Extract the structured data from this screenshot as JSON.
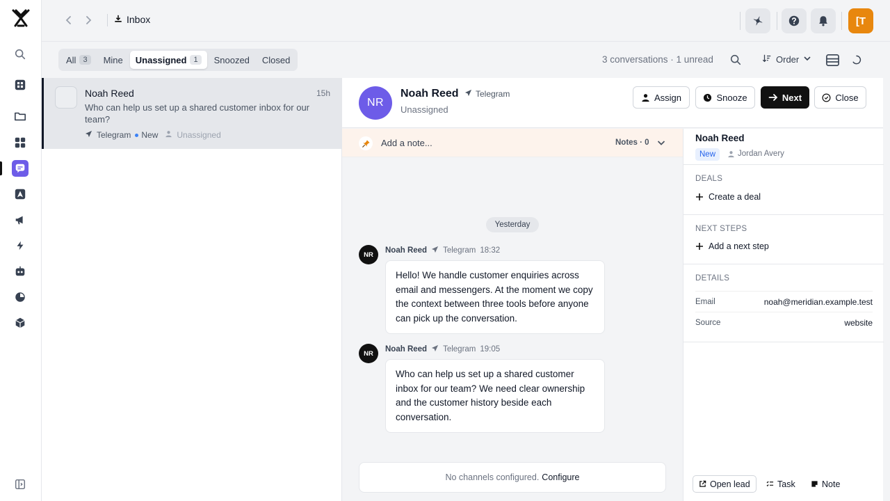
{
  "topbar": {
    "breadcrumb": "Inbox",
    "avatar_label": "[T"
  },
  "filters": [
    {
      "label": "All",
      "count": "3"
    },
    {
      "label": "Mine",
      "count": ""
    },
    {
      "label": "Unassigned",
      "count": "1"
    },
    {
      "label": "Snoozed",
      "count": ""
    },
    {
      "label": "Closed",
      "count": ""
    }
  ],
  "toolbar": {
    "summary": "3 conversations · 1 unread",
    "order_label": "Order"
  },
  "list": {
    "items": [
      {
        "name": "Noah Reed",
        "time": "15h",
        "preview": "Who can help us set up a shared customer inbox for our team?",
        "channel": "Telegram",
        "status": "New",
        "assignee": "Unassigned"
      }
    ]
  },
  "conversation": {
    "initials": "NR",
    "name": "Noah Reed",
    "channel": "Telegram",
    "status": "Unassigned",
    "actions": {
      "assign": "Assign",
      "snooze": "Snooze",
      "next": "Next",
      "close": "Close"
    },
    "note_placeholder": "Add a note...",
    "notes_count": "Notes · 0",
    "day_divider": "Yesterday",
    "messages": [
      {
        "initials": "NR",
        "author": "Noah Reed",
        "channel": "Telegram",
        "time": "18:32",
        "text": "Hello! We handle customer enquiries across email and messengers. At the moment we copy the context between three tools before anyone can pick up the conversation."
      },
      {
        "initials": "NR",
        "author": "Noah Reed",
        "channel": "Telegram",
        "time": "19:05",
        "text": "Who can help us set up a shared customer inbox for our team? We need clear ownership and the customer history beside each conversation."
      }
    ],
    "composer": {
      "text": "No channels configured.",
      "link": "Configure"
    }
  },
  "details_panel": {
    "name": "Noah Reed",
    "badge": "New",
    "owner": "Jordan Avery",
    "deals": {
      "title": "DEALS",
      "action": "Create a deal"
    },
    "next_steps": {
      "title": "NEXT STEPS",
      "action": "Add a next step"
    },
    "details": {
      "title": "DETAILS",
      "rows": [
        {
          "key": "Email",
          "value": "noah@meridian.example.test"
        },
        {
          "key": "Source",
          "value": "website"
        }
      ]
    },
    "footer": {
      "open_lead": "Open lead",
      "task": "Task",
      "note": "Note"
    }
  },
  "colors": {
    "accent": "#6d5ce8",
    "avatar_orange": "#e8870e",
    "badge_blue": "#2563eb"
  }
}
